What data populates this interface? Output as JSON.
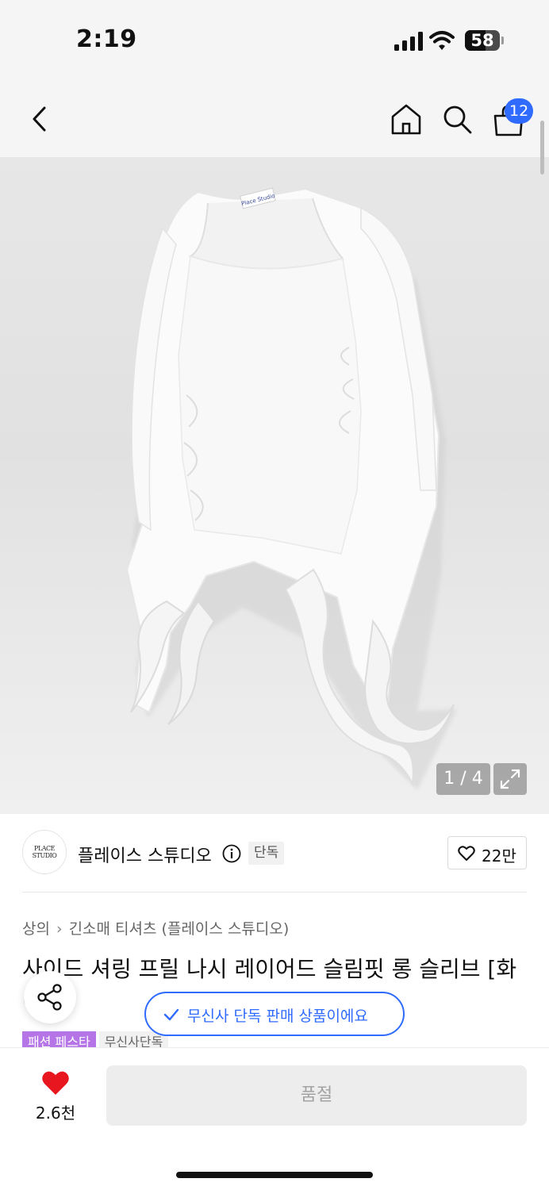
{
  "status_bar": {
    "time": "2:19",
    "battery_level": 58,
    "battery_text": "58"
  },
  "nav": {
    "back_icon": "chevron-left-icon",
    "home_icon": "home-icon",
    "search_icon": "search-icon",
    "cart_icon": "shopping-bag-icon",
    "cart_count": "12"
  },
  "gallery": {
    "pager": "1 / 4",
    "expand_icon": "expand-icon",
    "label_on_garment": "Place Studio"
  },
  "brand": {
    "logo_text": "PLACE STUDIO",
    "name": "플레이스 스튜디오",
    "info_icon": "info-icon",
    "exclusive_label": "단독",
    "likes": "22만"
  },
  "product": {
    "breadcrumb": [
      "상의",
      "긴소매 티셔츠 (플레이스 스튜디오)"
    ],
    "title": "사이드 셔링 프릴 나시 레이어드 슬림핏 롱 슬리브 [화이트]",
    "tags": [
      "패션 페스타",
      "무신사단독"
    ]
  },
  "toast": {
    "text": "무신사 단독 판매 상품이에요",
    "icon": "check-icon"
  },
  "share": {
    "icon": "share-icon"
  },
  "bottom": {
    "wish_count": "2.6천",
    "wish_icon": "heart-filled-icon",
    "buy_label": "품절"
  },
  "colors": {
    "accent_blue": "#2f6bff",
    "heart_red": "#e8161f",
    "festa_purple": "#b575e7"
  }
}
